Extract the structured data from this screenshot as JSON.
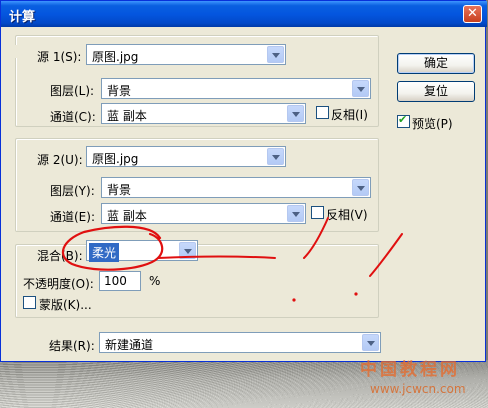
{
  "window": {
    "title": "计算",
    "close_glyph": "✕"
  },
  "source1": {
    "label": "源 1(S):",
    "value": "原图.jpg",
    "layer_label": "图层(L):",
    "layer_value": "背景",
    "channel_label": "通道(C):",
    "channel_value": "蓝 副本",
    "invert_label": "反相(I)"
  },
  "source2": {
    "label": "源 2(U):",
    "value": "原图.jpg",
    "layer_label": "图层(Y):",
    "layer_value": "背景",
    "channel_label": "通道(E):",
    "channel_value": "蓝 副本",
    "invert_label": "反相(V)"
  },
  "blend": {
    "label": "混合(B):",
    "value": "柔光",
    "opacity_label": "不透明度(O):",
    "opacity_value": "100",
    "opacity_unit": "%",
    "mask_label": "蒙版(K)..."
  },
  "result": {
    "label": "结果(R):",
    "value": "新建通道"
  },
  "buttons": {
    "ok": "确定",
    "reset": "复位",
    "preview": "预览(P)"
  },
  "watermark": {
    "text": "中国教程网",
    "url": "www.jcwcn.com"
  },
  "colors": {
    "title_blue": "#0456df",
    "annotation_red": "#e01010",
    "dialog_bg": "#ece9d8"
  }
}
